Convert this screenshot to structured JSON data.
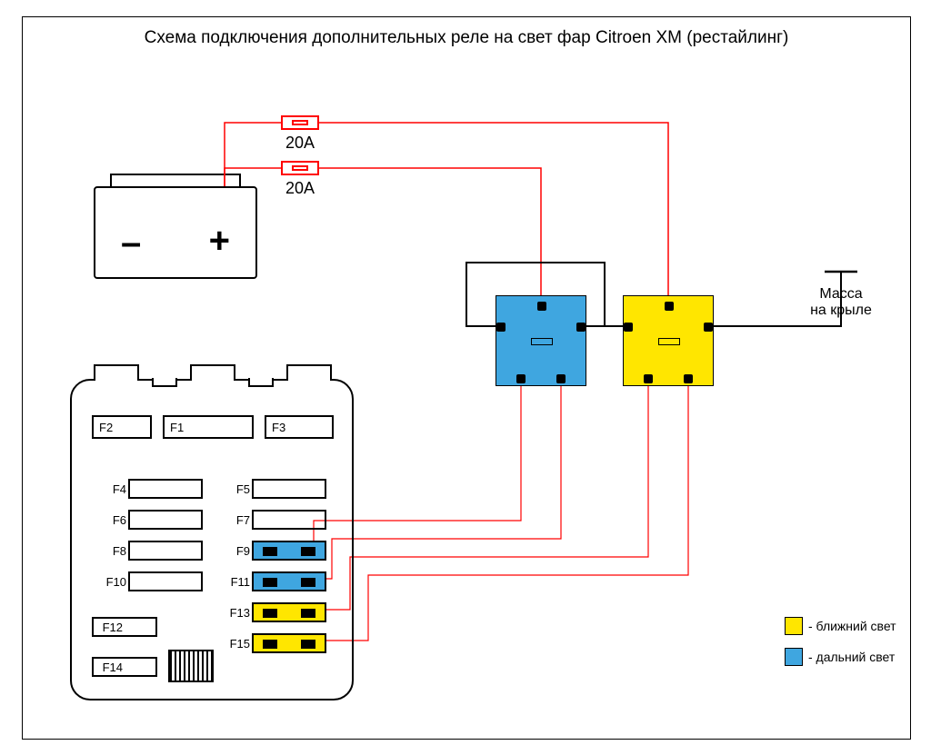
{
  "title": "Схема подключения дополнительных реле на свет фар Citroen XM (рестайлинг)",
  "battery": {
    "minus": "–",
    "plus": "+"
  },
  "fuses_inline": {
    "top": "20A",
    "bottom": "20A"
  },
  "ground": {
    "line1": "Масса",
    "line2": "на крыле"
  },
  "fusebox": {
    "big": {
      "f2": "F2",
      "f1": "F1",
      "f3": "F3"
    },
    "left_col": [
      "F4",
      "F6",
      "F8",
      "F10",
      "F12",
      "F14"
    ],
    "right_col": [
      "F5",
      "F7",
      "F9",
      "F11",
      "F13",
      "F15"
    ]
  },
  "legend": {
    "yellow": "- ближний свет",
    "blue": "- дальний свет"
  },
  "colors": {
    "red": "#ff0000",
    "black": "#000000",
    "blue": "#3fa6e0",
    "yellow": "#ffe600"
  }
}
